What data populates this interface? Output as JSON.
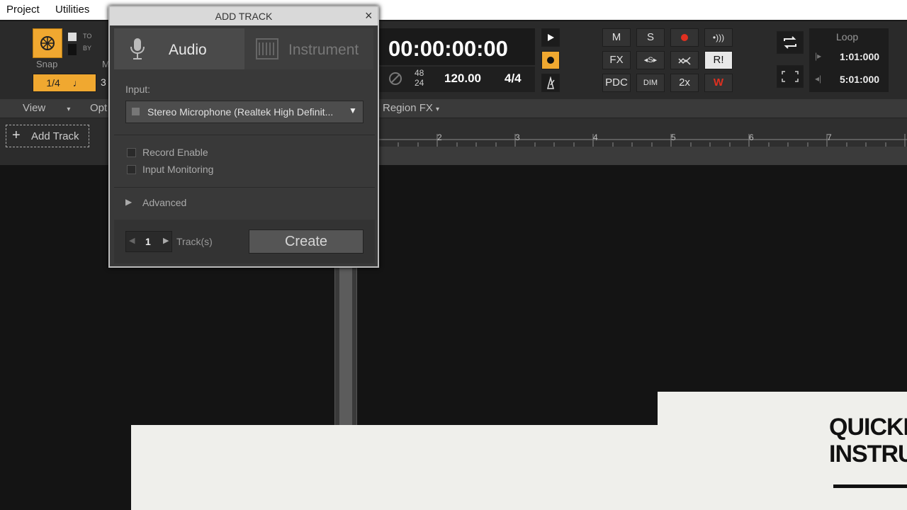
{
  "menu": {
    "items": [
      "Project",
      "Utilities"
    ]
  },
  "snap": {
    "label": "Snap",
    "to": "TO",
    "by": "BY",
    "value": "1/4",
    "note": "♩",
    "side": "3",
    "m": "M"
  },
  "transport": {
    "time": "00:00:00:00",
    "sample_top": "48",
    "sample_bottom": "24",
    "tempo": "120.00",
    "signature": "4/4"
  },
  "mix_buttons": {
    "m": "M",
    "s": "S",
    "fx": "FX",
    "pdc": "PDC",
    "dim": "DIM",
    "x2": "2x",
    "ri": "R!",
    "w": "W"
  },
  "loop": {
    "label": "Loop",
    "start": "1:01:000",
    "end": "5:01:000"
  },
  "viewbar": {
    "view": "View",
    "opt": "Opt",
    "region_fx": "Region FX"
  },
  "track_panel": {
    "add_track": "Add Track"
  },
  "ruler": {
    "marks": [
      "2",
      "3",
      "4",
      "5",
      "6",
      "7"
    ]
  },
  "dialog": {
    "title": "ADD TRACK",
    "close": "×",
    "tab_audio": "Audio",
    "tab_instrument": "Instrument",
    "input_label": "Input:",
    "input_value": "Stereo Microphone (Realtek High Definit...",
    "record_enable": "Record Enable",
    "input_monitoring": "Input Monitoring",
    "advanced": "Advanced",
    "track_count": "1",
    "tracks_label": "Track(s)",
    "create": "Create"
  },
  "overlay": {
    "heading_line1": "QUICKL",
    "heading_line2": "INSTRU"
  },
  "colors": {
    "accent": "#f0a830",
    "record": "#e03020",
    "bg": "#141414"
  }
}
